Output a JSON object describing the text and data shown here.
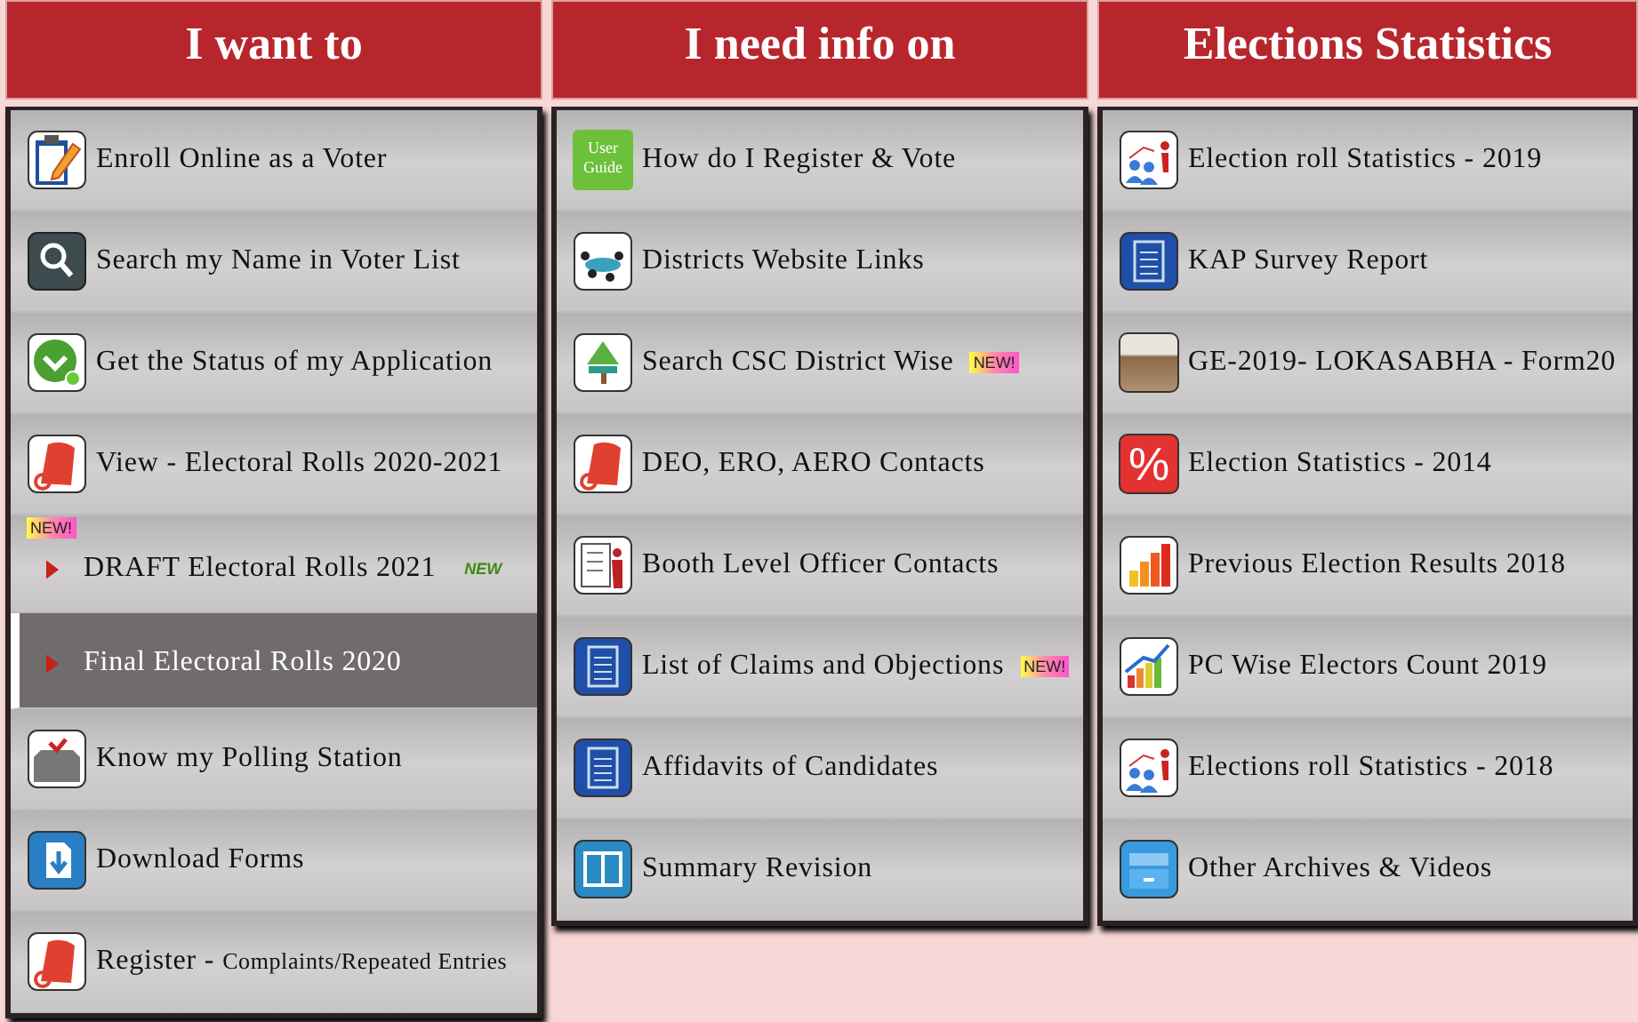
{
  "columns": [
    {
      "title": "I want to",
      "items": [
        {
          "kind": "icon",
          "label": "Enroll Online as a Voter",
          "selected": false
        },
        {
          "kind": "icon",
          "label": "Search my Name in Voter List",
          "selected": false
        },
        {
          "kind": "icon",
          "label": "Get the Status of my Application",
          "selected": false
        },
        {
          "kind": "icon",
          "label": "View - Electoral Rolls 2020-2021",
          "selected": false
        },
        {
          "kind": "bullet",
          "label": "DRAFT Electoral Rolls 2021",
          "selected": false,
          "badge_before": "NEW!",
          "badge_after": "NEW"
        },
        {
          "kind": "bullet",
          "label": "Final Electoral Rolls 2020",
          "selected": true
        },
        {
          "kind": "icon",
          "label": "Know my Polling Station",
          "selected": false
        },
        {
          "kind": "icon",
          "label": "Download Forms",
          "selected": false
        },
        {
          "kind": "icon",
          "label": "Register -",
          "note": "Complaints/Repeated Entries",
          "selected": false
        }
      ]
    },
    {
      "title": "I need info on",
      "items": [
        {
          "kind": "icon",
          "label": "How do I Register & Vote",
          "icon_text": "User Guide",
          "selected": false
        },
        {
          "kind": "icon",
          "label": "Districts Website Links",
          "selected": false
        },
        {
          "kind": "icon",
          "label": "Search CSC District Wise",
          "badge_after": "NEW!",
          "selected": false
        },
        {
          "kind": "icon",
          "label": "DEO, ERO, AERO Contacts",
          "selected": false
        },
        {
          "kind": "icon",
          "label": "Booth Level Officer Contacts",
          "selected": false
        },
        {
          "kind": "icon",
          "label": "List of Claims and Objections",
          "badge_after": "NEW!",
          "selected": false
        },
        {
          "kind": "icon",
          "label": "Affidavits of Candidates",
          "selected": false
        },
        {
          "kind": "icon",
          "label": "Summary Revision",
          "selected": false
        }
      ]
    },
    {
      "title": "Elections Statistics",
      "items": [
        {
          "kind": "icon",
          "label": "Election roll Statistics - 2019",
          "selected": false
        },
        {
          "kind": "icon",
          "label": "KAP Survey Report",
          "selected": false
        },
        {
          "kind": "icon",
          "label": "GE-2019- LOKASABHA - Form20",
          "selected": false
        },
        {
          "kind": "icon",
          "label": "Election Statistics - 2014",
          "icon_text": "%",
          "selected": false
        },
        {
          "kind": "icon",
          "label": "Previous Election Results 2018",
          "selected": false
        },
        {
          "kind": "icon",
          "label": "PC Wise Electors Count 2019",
          "selected": false
        },
        {
          "kind": "icon",
          "label": "Elections roll Statistics - 2018",
          "selected": false
        },
        {
          "kind": "icon",
          "label": "Other Archives & Videos",
          "selected": false
        }
      ]
    }
  ]
}
